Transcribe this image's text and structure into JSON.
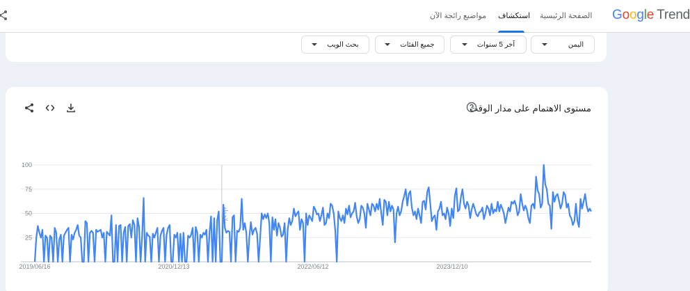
{
  "header": {
    "logo_google": "Google",
    "logo_trends": "Trends",
    "nav": [
      {
        "label": "الصفحة الرئيسية"
      },
      {
        "label": "استكشاف"
      },
      {
        "label": "مواضيع رائجة الآن"
      }
    ]
  },
  "filters": {
    "location": "اليمن",
    "time_range": "آخر 5 سنوات",
    "category": "جميع الفئات",
    "search_type": "بحث الويب"
  },
  "chart_card": {
    "title": "مستوى الاهتمام على مدار الوقت",
    "annotation": "ملاحظة"
  },
  "colors": {
    "line": "#4285f4",
    "accent": "#1a73e8"
  },
  "chart_data": {
    "type": "line",
    "title": "مستوى الاهتمام على مدار الوقت",
    "ylim": [
      0,
      100
    ],
    "y_ticks": [
      25,
      50,
      75,
      100
    ],
    "x_tick_labels": [
      "2019/06/16",
      "2020/12/13",
      "2022/06/12",
      "2023/12/10"
    ],
    "grid": true,
    "annotation_x_index": 122,
    "series": [
      {
        "values": [
          0,
          25,
          37,
          30,
          25,
          33,
          0,
          27,
          25,
          0,
          27,
          25,
          0,
          35,
          30,
          0,
          23,
          28,
          0,
          27,
          30,
          33,
          35,
          0,
          28,
          23,
          30,
          33,
          38,
          27,
          25,
          0,
          0,
          42,
          40,
          0,
          30,
          32,
          30,
          0,
          33,
          31,
          32,
          33,
          25,
          30,
          0,
          31,
          29,
          27,
          48,
          0,
          0,
          38,
          0,
          37,
          38,
          0,
          30,
          36,
          0,
          37,
          39,
          25,
          43,
          38,
          0,
          45,
          36,
          0,
          26,
          66,
          0,
          30,
          27,
          26,
          0,
          29,
          25,
          30,
          35,
          0,
          27,
          32,
          35,
          0,
          28,
          35,
          38,
          0,
          0,
          28,
          25,
          30,
          0,
          29,
          0,
          30,
          0,
          0,
          27,
          25,
          28,
          35,
          0,
          36,
          30,
          0,
          28,
          25,
          30,
          28,
          33,
          0,
          30,
          47,
          0,
          45,
          0,
          43,
          52,
          0,
          0,
          59,
          35,
          30,
          32,
          31,
          0,
          46,
          48,
          0,
          32,
          31,
          35,
          65,
          33,
          40,
          30,
          0,
          26,
          41,
          28,
          33,
          35,
          29,
          0,
          25,
          50,
          44,
          49,
          45,
          50,
          40,
          0,
          46,
          33,
          44,
          27,
          40,
          35,
          26,
          28,
          40,
          0,
          33,
          45,
          38,
          42,
          55,
          47,
          50,
          52,
          33,
          44,
          40,
          0,
          50,
          38,
          48,
          45,
          42,
          57,
          54,
          49,
          50,
          42,
          48,
          56,
          38,
          40,
          50,
          45,
          60,
          58,
          50,
          32,
          0,
          52,
          45,
          42,
          48,
          40,
          55,
          49,
          58,
          46,
          50,
          52,
          61,
          47,
          40,
          44,
          58,
          56,
          50,
          35,
          60,
          54,
          48,
          60,
          58,
          52,
          60,
          54,
          65,
          50,
          38,
          64,
          62,
          48,
          62,
          52,
          58,
          54,
          20,
          50,
          57,
          48,
          52,
          62,
          68,
          75,
          58,
          70,
          73,
          56,
          48,
          52,
          44,
          55,
          48,
          40,
          62,
          63,
          54,
          72,
          77,
          60,
          42,
          46,
          48,
          33,
          52,
          55,
          62,
          48,
          50,
          44,
          56,
          50,
          37,
          55,
          45,
          68,
          76,
          52,
          54,
          67,
          75,
          60,
          55,
          62,
          58,
          45,
          54,
          60,
          55,
          49,
          47,
          51,
          52,
          56,
          44,
          50,
          58,
          55,
          48,
          60,
          50,
          54,
          52,
          62,
          52,
          59,
          55,
          50,
          40,
          48,
          56,
          52,
          62,
          60,
          63,
          58,
          48,
          52,
          70,
          60,
          53,
          58,
          54,
          45,
          40,
          58,
          60,
          55,
          88,
          74,
          70,
          56,
          60,
          100,
          80,
          75,
          60,
          58,
          34,
          72,
          62,
          68,
          70,
          63,
          55,
          60,
          72,
          69,
          56,
          60,
          48,
          45,
          38,
          42,
          60,
          42,
          36,
          65,
          55,
          62,
          70,
          58,
          52,
          55,
          52
        ]
      }
    ]
  }
}
